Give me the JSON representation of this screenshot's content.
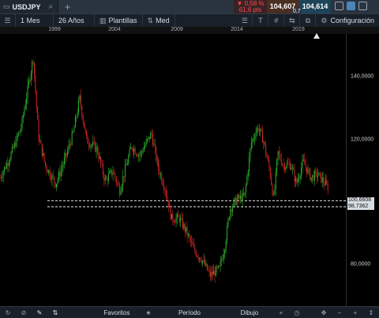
{
  "instrument": {
    "symbol": "USDJPY"
  },
  "quote": {
    "change_percent": "▼ 0,58 %",
    "change_pips": "61,6 pts",
    "bid": "104,607",
    "ask": "104,614",
    "spread": "0,7",
    "colors": {
      "down": "#ff4a4a",
      "bid_bg": "#4a2e22",
      "ask_bg": "#1d4458"
    }
  },
  "toolbar": {
    "interval": "1 Mes",
    "range": "26 Años",
    "templates_label": "Plantillas",
    "price_type": "Med",
    "settings_label": "Configuración"
  },
  "x_axis": {
    "years": [
      "1999",
      "2004",
      "2009",
      "2014",
      "2019"
    ]
  },
  "y_axis": {
    "labels": [
      "140,0000",
      "120,0000",
      "80,0000"
    ]
  },
  "price_lines": [
    "100,6608",
    "98,7362"
  ],
  "bottom": {
    "favorites_label": "Favoritos",
    "period_label": "Período",
    "drawing_label": "Dibujo"
  },
  "chart_data": {
    "type": "candlestick",
    "title": "",
    "x_range": [
      "1996",
      "2020"
    ],
    "y_range": [
      72,
      150
    ],
    "y_ticks": [
      80,
      120,
      140
    ],
    "reference_lines": [
      100.6608,
      98.7362
    ],
    "colors": {
      "up": "#2bb52b",
      "down": "#d42626"
    },
    "series": [
      {
        "name": "USDJPY",
        "approx_path": [
          [
            1996.0,
            108
          ],
          [
            1996.8,
            115
          ],
          [
            1997.6,
            124
          ],
          [
            1998.0,
            134
          ],
          [
            1998.5,
            146
          ],
          [
            1998.9,
            121
          ],
          [
            1999.4,
            112
          ],
          [
            2000.2,
            106
          ],
          [
            2000.9,
            114
          ],
          [
            2001.5,
            122
          ],
          [
            2002.0,
            133
          ],
          [
            2002.5,
            120
          ],
          [
            2003.3,
            117
          ],
          [
            2003.9,
            107
          ],
          [
            2004.5,
            110
          ],
          [
            2005.0,
            104
          ],
          [
            2005.9,
            118
          ],
          [
            2006.5,
            115
          ],
          [
            2007.4,
            122
          ],
          [
            2007.9,
            111
          ],
          [
            2008.4,
            105
          ],
          [
            2008.9,
            95
          ],
          [
            2009.5,
            95
          ],
          [
            2010.0,
            91
          ],
          [
            2010.6,
            85
          ],
          [
            2011.2,
            82
          ],
          [
            2011.8,
            77
          ],
          [
            2012.5,
            79
          ],
          [
            2012.9,
            86
          ],
          [
            2013.3,
            98
          ],
          [
            2013.8,
            101
          ],
          [
            2014.4,
            102
          ],
          [
            2014.9,
            119
          ],
          [
            2015.4,
            124
          ],
          [
            2015.8,
            120
          ],
          [
            2016.3,
            110
          ],
          [
            2016.6,
            101
          ],
          [
            2016.9,
            116
          ],
          [
            2017.3,
            112
          ],
          [
            2017.9,
            112
          ],
          [
            2018.3,
            106
          ],
          [
            2018.8,
            113
          ],
          [
            2019.4,
            108
          ],
          [
            2019.9,
            109
          ],
          [
            2020.3,
            107
          ],
          [
            2020.7,
            104.6
          ]
        ]
      }
    ]
  }
}
